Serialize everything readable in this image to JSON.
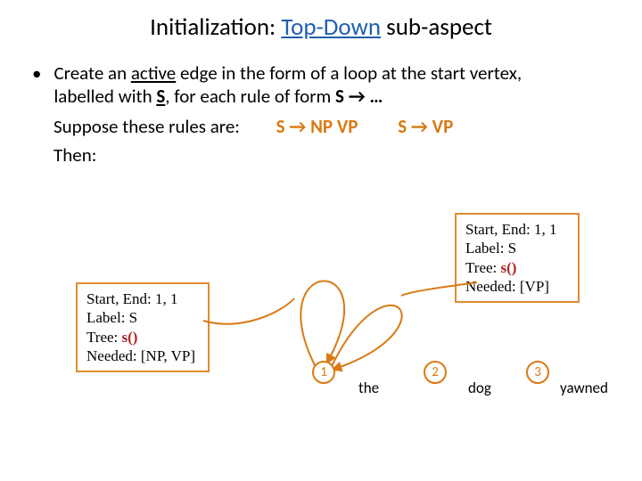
{
  "title": {
    "prefix": "Initialization: ",
    "highlight": "Top-Down",
    "suffix": " sub-aspect"
  },
  "bullet": {
    "t1": "Create an ",
    "active": "active",
    "t2": " edge in the form of a loop at the start vertex,",
    "t3": "labelled with ",
    "S": "S",
    "t4": ", for each rule of form ",
    "rule_form": "S → …"
  },
  "suppose_label": "Suppose these rules are:",
  "rule1": "S → NP VP",
  "rule2": "S →  VP",
  "then_label": "Then:",
  "annot_left": {
    "l1": "Start, End: 1, 1",
    "l2": "Label: S",
    "l3a": "Tree: ",
    "l3b": "s()",
    "l4": "Needed: [NP, VP]"
  },
  "annot_right": {
    "l1": "Start, End: 1, 1",
    "l2": "Label: S",
    "l3a": "Tree: ",
    "l3b": "s()",
    "l4": "Needed: [VP]"
  },
  "nodes": {
    "n1": "1",
    "n2": "2",
    "n3": "3"
  },
  "words": {
    "w1": "the",
    "w2": "dog",
    "w3": "yawned"
  }
}
